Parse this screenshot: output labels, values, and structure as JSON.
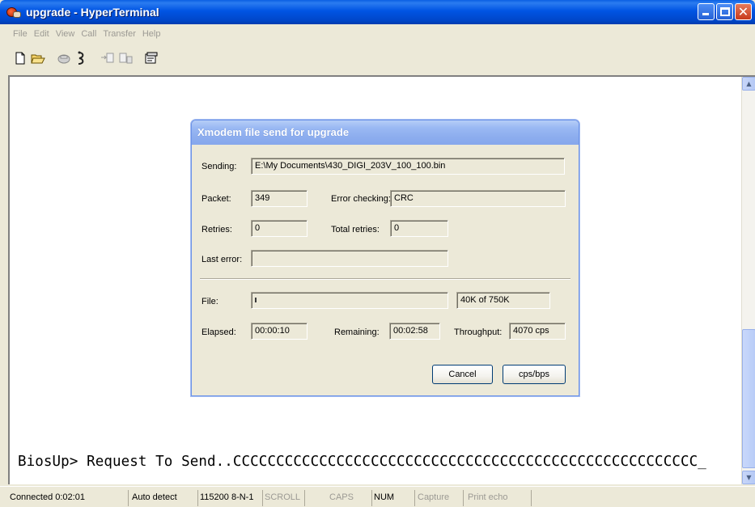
{
  "window": {
    "title": "upgrade - HyperTerminal",
    "icon": "hyperterminal-phone-icon"
  },
  "menu": [
    "File",
    "Edit",
    "View",
    "Call",
    "Transfer",
    "Help"
  ],
  "toolbar": {
    "icons": [
      "new-icon",
      "open-icon",
      "connect-icon",
      "disconnect-icon",
      "send-icon",
      "receive-icon",
      "properties-icon"
    ]
  },
  "terminal": {
    "line": "BiosUp> Request To Send..CCCCCCCCCCCCCCCCCCCCCCCCCCCCCCCCCCCCCCCCCCCCCCCCCCCCCC_"
  },
  "dialog": {
    "title": "Xmodem file send for upgrade",
    "sending_label": "Sending:",
    "sending_value": "E:\\My Documents\\430_DIGI_203V_100_100.bin",
    "packet_label": "Packet:",
    "packet_value": "349",
    "error_checking_label": "Error checking:",
    "error_checking_value": "CRC",
    "retries_label": "Retries:",
    "retries_value": "0",
    "total_retries_label": "Total retries:",
    "total_retries_value": "0",
    "last_error_label": "Last error:",
    "last_error_value": "",
    "file_label": "File:",
    "file_progress": 0.053,
    "file_size_text": "40K of 750K",
    "elapsed_label": "Elapsed:",
    "elapsed_value": "00:00:10",
    "remaining_label": "Remaining:",
    "remaining_value": "00:02:58",
    "throughput_label": "Throughput:",
    "throughput_value": "4070 cps",
    "cancel_label": "Cancel",
    "cpsbps_label": "cps/bps"
  },
  "status": {
    "connected": "Connected 0:02:01",
    "detect": "Auto detect",
    "settings": "115200 8-N-1",
    "scroll": "SCROLL",
    "caps": "CAPS",
    "num": "NUM",
    "capture": "Capture",
    "print_echo": "Print echo"
  }
}
